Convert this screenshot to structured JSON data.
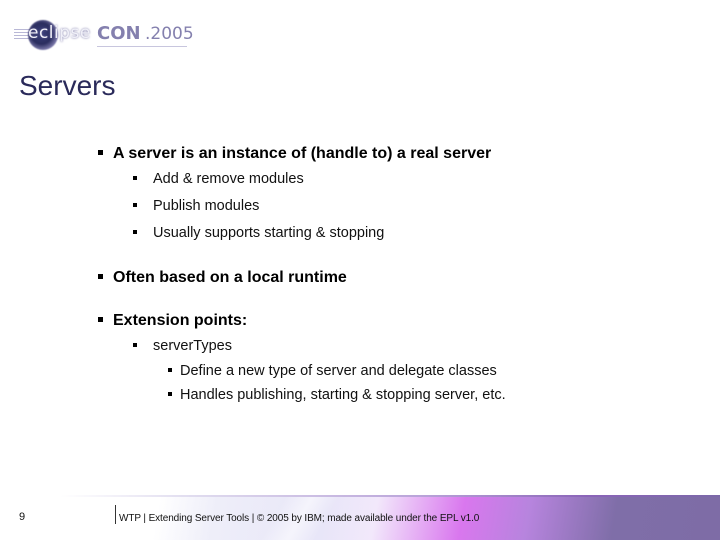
{
  "logo": {
    "eclipse_text": "eclipse",
    "con_text": "CON",
    "year_text": ".2005"
  },
  "slide": {
    "title": "Servers",
    "bullets": [
      {
        "level": 1,
        "text": "A server is an instance of (handle to) a real server"
      },
      {
        "level": 2,
        "text": "Add & remove modules"
      },
      {
        "level": 2,
        "text": "Publish modules"
      },
      {
        "level": 2,
        "text": "Usually supports starting & stopping"
      },
      {
        "level": 1,
        "text": "Often based on a local runtime"
      },
      {
        "level": 1,
        "text": "Extension points:"
      },
      {
        "level": 2,
        "text": "serverTypes"
      },
      {
        "level": 3,
        "text": "Define a new type of server and delegate classes"
      },
      {
        "level": 3,
        "text": "Handles publishing, starting & stopping server, etc."
      }
    ]
  },
  "footer": {
    "page_number": "9",
    "text": "WTP  |  Extending Server Tools  |  © 2005 by IBM; made available under the EPL v1.0"
  },
  "colors": {
    "title": "#2a2a5a",
    "logo_accent": "#8480ae",
    "footer_purple": "#7e6ca6",
    "footer_magenta": "#d977ee"
  }
}
